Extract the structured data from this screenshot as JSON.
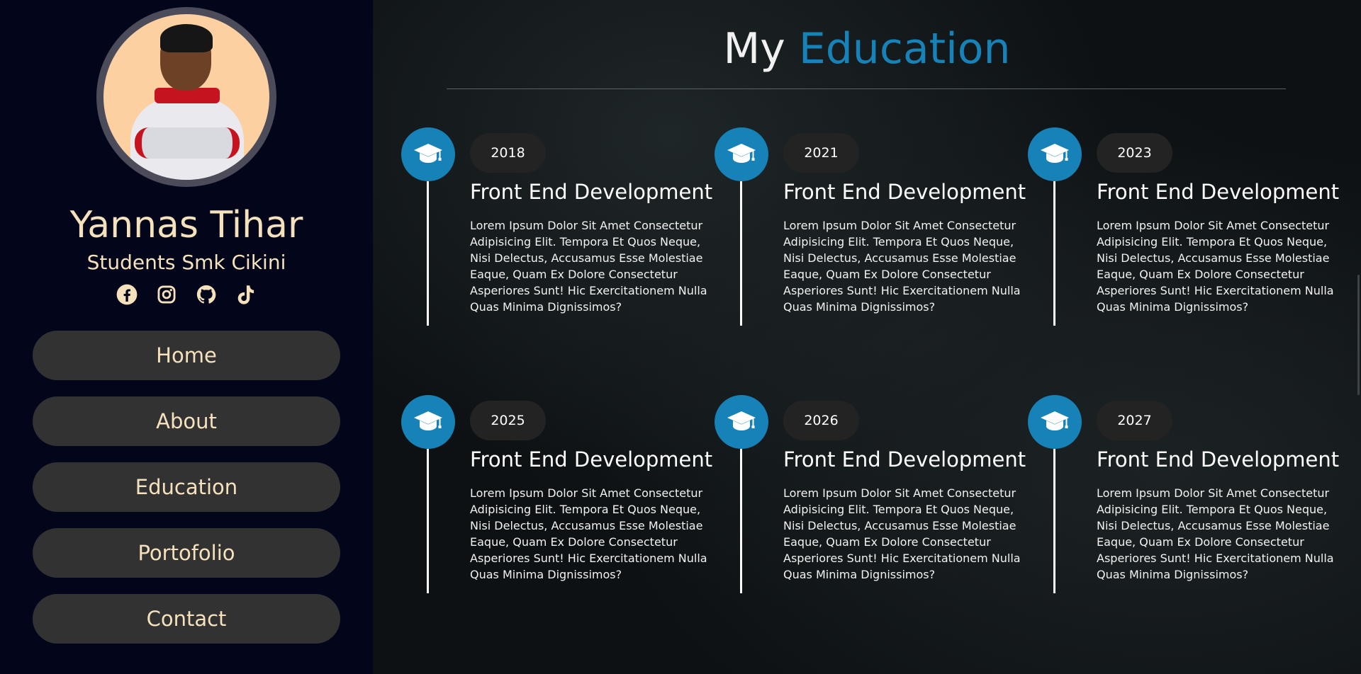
{
  "profile": {
    "name": "Yannas Tihar",
    "role": "Students Smk Cikini",
    "socials": [
      {
        "icon": "facebook-icon"
      },
      {
        "icon": "instagram-icon"
      },
      {
        "icon": "github-icon"
      },
      {
        "icon": "tiktok-icon"
      }
    ]
  },
  "nav": {
    "items": [
      {
        "label": "Home"
      },
      {
        "label": "About"
      },
      {
        "label": "Education"
      },
      {
        "label": "Portofolio"
      },
      {
        "label": "Contact"
      }
    ]
  },
  "section": {
    "title_part1": "My",
    "title_part2": "Education"
  },
  "education": [
    {
      "year": "2018",
      "title": "Front End Development",
      "description": "Lorem Ipsum Dolor Sit Amet Consectetur Adipisicing Elit. Tempora Et Quos Neque, Nisi Delectus, Accusamus Esse Molestiae Eaque, Quam Ex Dolore Consectetur Asperiores Sunt! Hic Exercitationem Nulla Quas Minima Dignissimos?"
    },
    {
      "year": "2021",
      "title": "Front End Development",
      "description": "Lorem Ipsum Dolor Sit Amet Consectetur Adipisicing Elit. Tempora Et Quos Neque, Nisi Delectus, Accusamus Esse Molestiae Eaque, Quam Ex Dolore Consectetur Asperiores Sunt! Hic Exercitationem Nulla Quas Minima Dignissimos?"
    },
    {
      "year": "2023",
      "title": "Front End Development",
      "description": "Lorem Ipsum Dolor Sit Amet Consectetur Adipisicing Elit. Tempora Et Quos Neque, Nisi Delectus, Accusamus Esse Molestiae Eaque, Quam Ex Dolore Consectetur Asperiores Sunt! Hic Exercitationem Nulla Quas Minima Dignissimos?"
    },
    {
      "year": "2025",
      "title": "Front End Development",
      "description": "Lorem Ipsum Dolor Sit Amet Consectetur Adipisicing Elit. Tempora Et Quos Neque, Nisi Delectus, Accusamus Esse Molestiae Eaque, Quam Ex Dolore Consectetur Asperiores Sunt! Hic Exercitationem Nulla Quas Minima Dignissimos?"
    },
    {
      "year": "2026",
      "title": "Front End Development",
      "description": "Lorem Ipsum Dolor Sit Amet Consectetur Adipisicing Elit. Tempora Et Quos Neque, Nisi Delectus, Accusamus Esse Molestiae Eaque, Quam Ex Dolore Consectetur Asperiores Sunt! Hic Exercitationem Nulla Quas Minima Dignissimos?"
    },
    {
      "year": "2027",
      "title": "Front End Development",
      "description": "Lorem Ipsum Dolor Sit Amet Consectetur Adipisicing Elit. Tempora Et Quos Neque, Nisi Delectus, Accusamus Esse Molestiae Eaque, Quam Ex Dolore Consectetur Asperiores Sunt! Hic Exercitationem Nulla Quas Minima Dignissimos?"
    }
  ],
  "colors": {
    "accent": "#1682b7",
    "name_text": "#f5e2bd",
    "sidebar_bg": "#03061a",
    "nav_button_bg": "#323232"
  }
}
